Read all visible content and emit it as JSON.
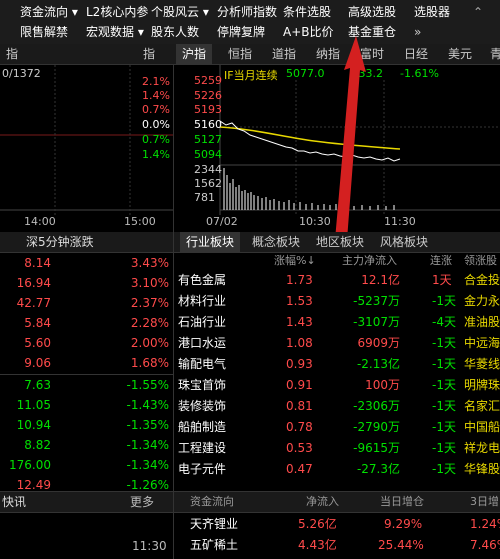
{
  "menu": {
    "row1": [
      {
        "label": "资金流向 ▾"
      },
      {
        "label": "L2核心内参"
      },
      {
        "label": "个股风云 ▾"
      },
      {
        "label": "分析师指数"
      },
      {
        "label": "条件选股"
      },
      {
        "label": "高级选股"
      },
      {
        "label": "选股器"
      }
    ],
    "row2": [
      {
        "label": "限售解禁"
      },
      {
        "label": "宏观数据 ▾"
      },
      {
        "label": "股东人数"
      },
      {
        "label": "停牌复牌"
      },
      {
        "label": "A+B比价"
      },
      {
        "label": "基金重仓"
      }
    ],
    "chevron_up": "⌃",
    "chevron_more": "»"
  },
  "index_tabs": [
    "指",
    "指",
    "沪指",
    "恒指",
    "道指",
    "纳指",
    "富时",
    "日经",
    "美元",
    "青"
  ],
  "left_chart": {
    "header": "0/1372",
    "pcts": [
      {
        "v": "2.1%",
        "c": "red"
      },
      {
        "v": "1.4%",
        "c": "red"
      },
      {
        "v": "0.7%",
        "c": "red"
      },
      {
        "v": "0.0%",
        "c": "white"
      },
      {
        "v": "0.7%",
        "c": "green"
      },
      {
        "v": "1.4%",
        "c": "green"
      }
    ],
    "times": [
      "14:00",
      "15:00"
    ]
  },
  "if_chart": {
    "title": "IF当月连续",
    "price": "5077.0",
    "change": "▼33.2",
    "pct": "-1.61%",
    "y_labels": [
      "5259",
      "5226",
      "5193",
      "5160",
      "5127",
      "5094"
    ],
    "vol_labels": [
      "2344",
      "1562",
      "781"
    ],
    "times": [
      "07/02",
      "10:30",
      "11:30"
    ]
  },
  "rise_fall": {
    "title": "深5分钟涨跌",
    "up": [
      {
        "price": "8.14",
        "pct": "3.43%"
      },
      {
        "price": "16.94",
        "pct": "3.10%"
      },
      {
        "price": "42.77",
        "pct": "2.37%"
      },
      {
        "price": "5.84",
        "pct": "2.28%"
      },
      {
        "price": "5.60",
        "pct": "2.00%"
      },
      {
        "price": "9.06",
        "pct": "1.68%"
      }
    ],
    "down": [
      {
        "price": "7.63",
        "pct": "-1.55%"
      },
      {
        "price": "11.05",
        "pct": "-1.43%"
      },
      {
        "price": "10.94",
        "pct": "-1.35%"
      },
      {
        "price": "8.82",
        "pct": "-1.34%"
      },
      {
        "price": "176.00",
        "pct": "-1.34%"
      },
      {
        "price": "12.49",
        "pct": "-1.26%"
      }
    ]
  },
  "sector": {
    "tabs": [
      "行业板块",
      "概念板块",
      "地区板块",
      "风格板块"
    ],
    "headers": [
      "涨幅%↓",
      "主力净流入",
      "连涨",
      "领涨股"
    ],
    "rows": [
      {
        "name": "有色金属",
        "chg": "1.73",
        "flow": "12.1亿",
        "streak": "1天",
        "lead": "合金投"
      },
      {
        "name": "材料行业",
        "chg": "1.53",
        "flow": "-5237万",
        "streak": "-1天",
        "lead": "金力永"
      },
      {
        "name": "石油行业",
        "chg": "1.43",
        "flow": "-3107万",
        "streak": "-4天",
        "lead": "准油股"
      },
      {
        "name": "港口水运",
        "chg": "1.08",
        "flow": "6909万",
        "streak": "-1天",
        "lead": "中远海"
      },
      {
        "name": "输配电气",
        "chg": "0.93",
        "flow": "-2.13亿",
        "streak": "-1天",
        "lead": "华菱线"
      },
      {
        "name": "珠宝首饰",
        "chg": "0.91",
        "flow": "100万",
        "streak": "-1天",
        "lead": "明牌珠"
      },
      {
        "name": "装修装饰",
        "chg": "0.81",
        "flow": "-2306万",
        "streak": "-1天",
        "lead": "名家汇"
      },
      {
        "name": "船舶制造",
        "chg": "0.78",
        "flow": "-2790万",
        "streak": "-1天",
        "lead": "中国船"
      },
      {
        "name": "工程建设",
        "chg": "0.53",
        "flow": "-9615万",
        "streak": "-1天",
        "lead": "祥龙电"
      },
      {
        "name": "电子元件",
        "chg": "0.47",
        "flow": "-27.3亿",
        "streak": "-1天",
        "lead": "华锋股"
      }
    ]
  },
  "news": {
    "title": "快讯",
    "more": "更多",
    "time": "11:30"
  },
  "fund_flow": {
    "headers": [
      "资金流向",
      "净流入",
      "当日增仓",
      "3日增"
    ],
    "rows": [
      {
        "name": "天齐锂业",
        "net": "5.26亿",
        "inc": "9.29%",
        "inc3": "1.24%"
      },
      {
        "name": "五矿稀土",
        "net": "4.43亿",
        "inc": "25.44%",
        "inc3": "7.46%"
      }
    ]
  }
}
